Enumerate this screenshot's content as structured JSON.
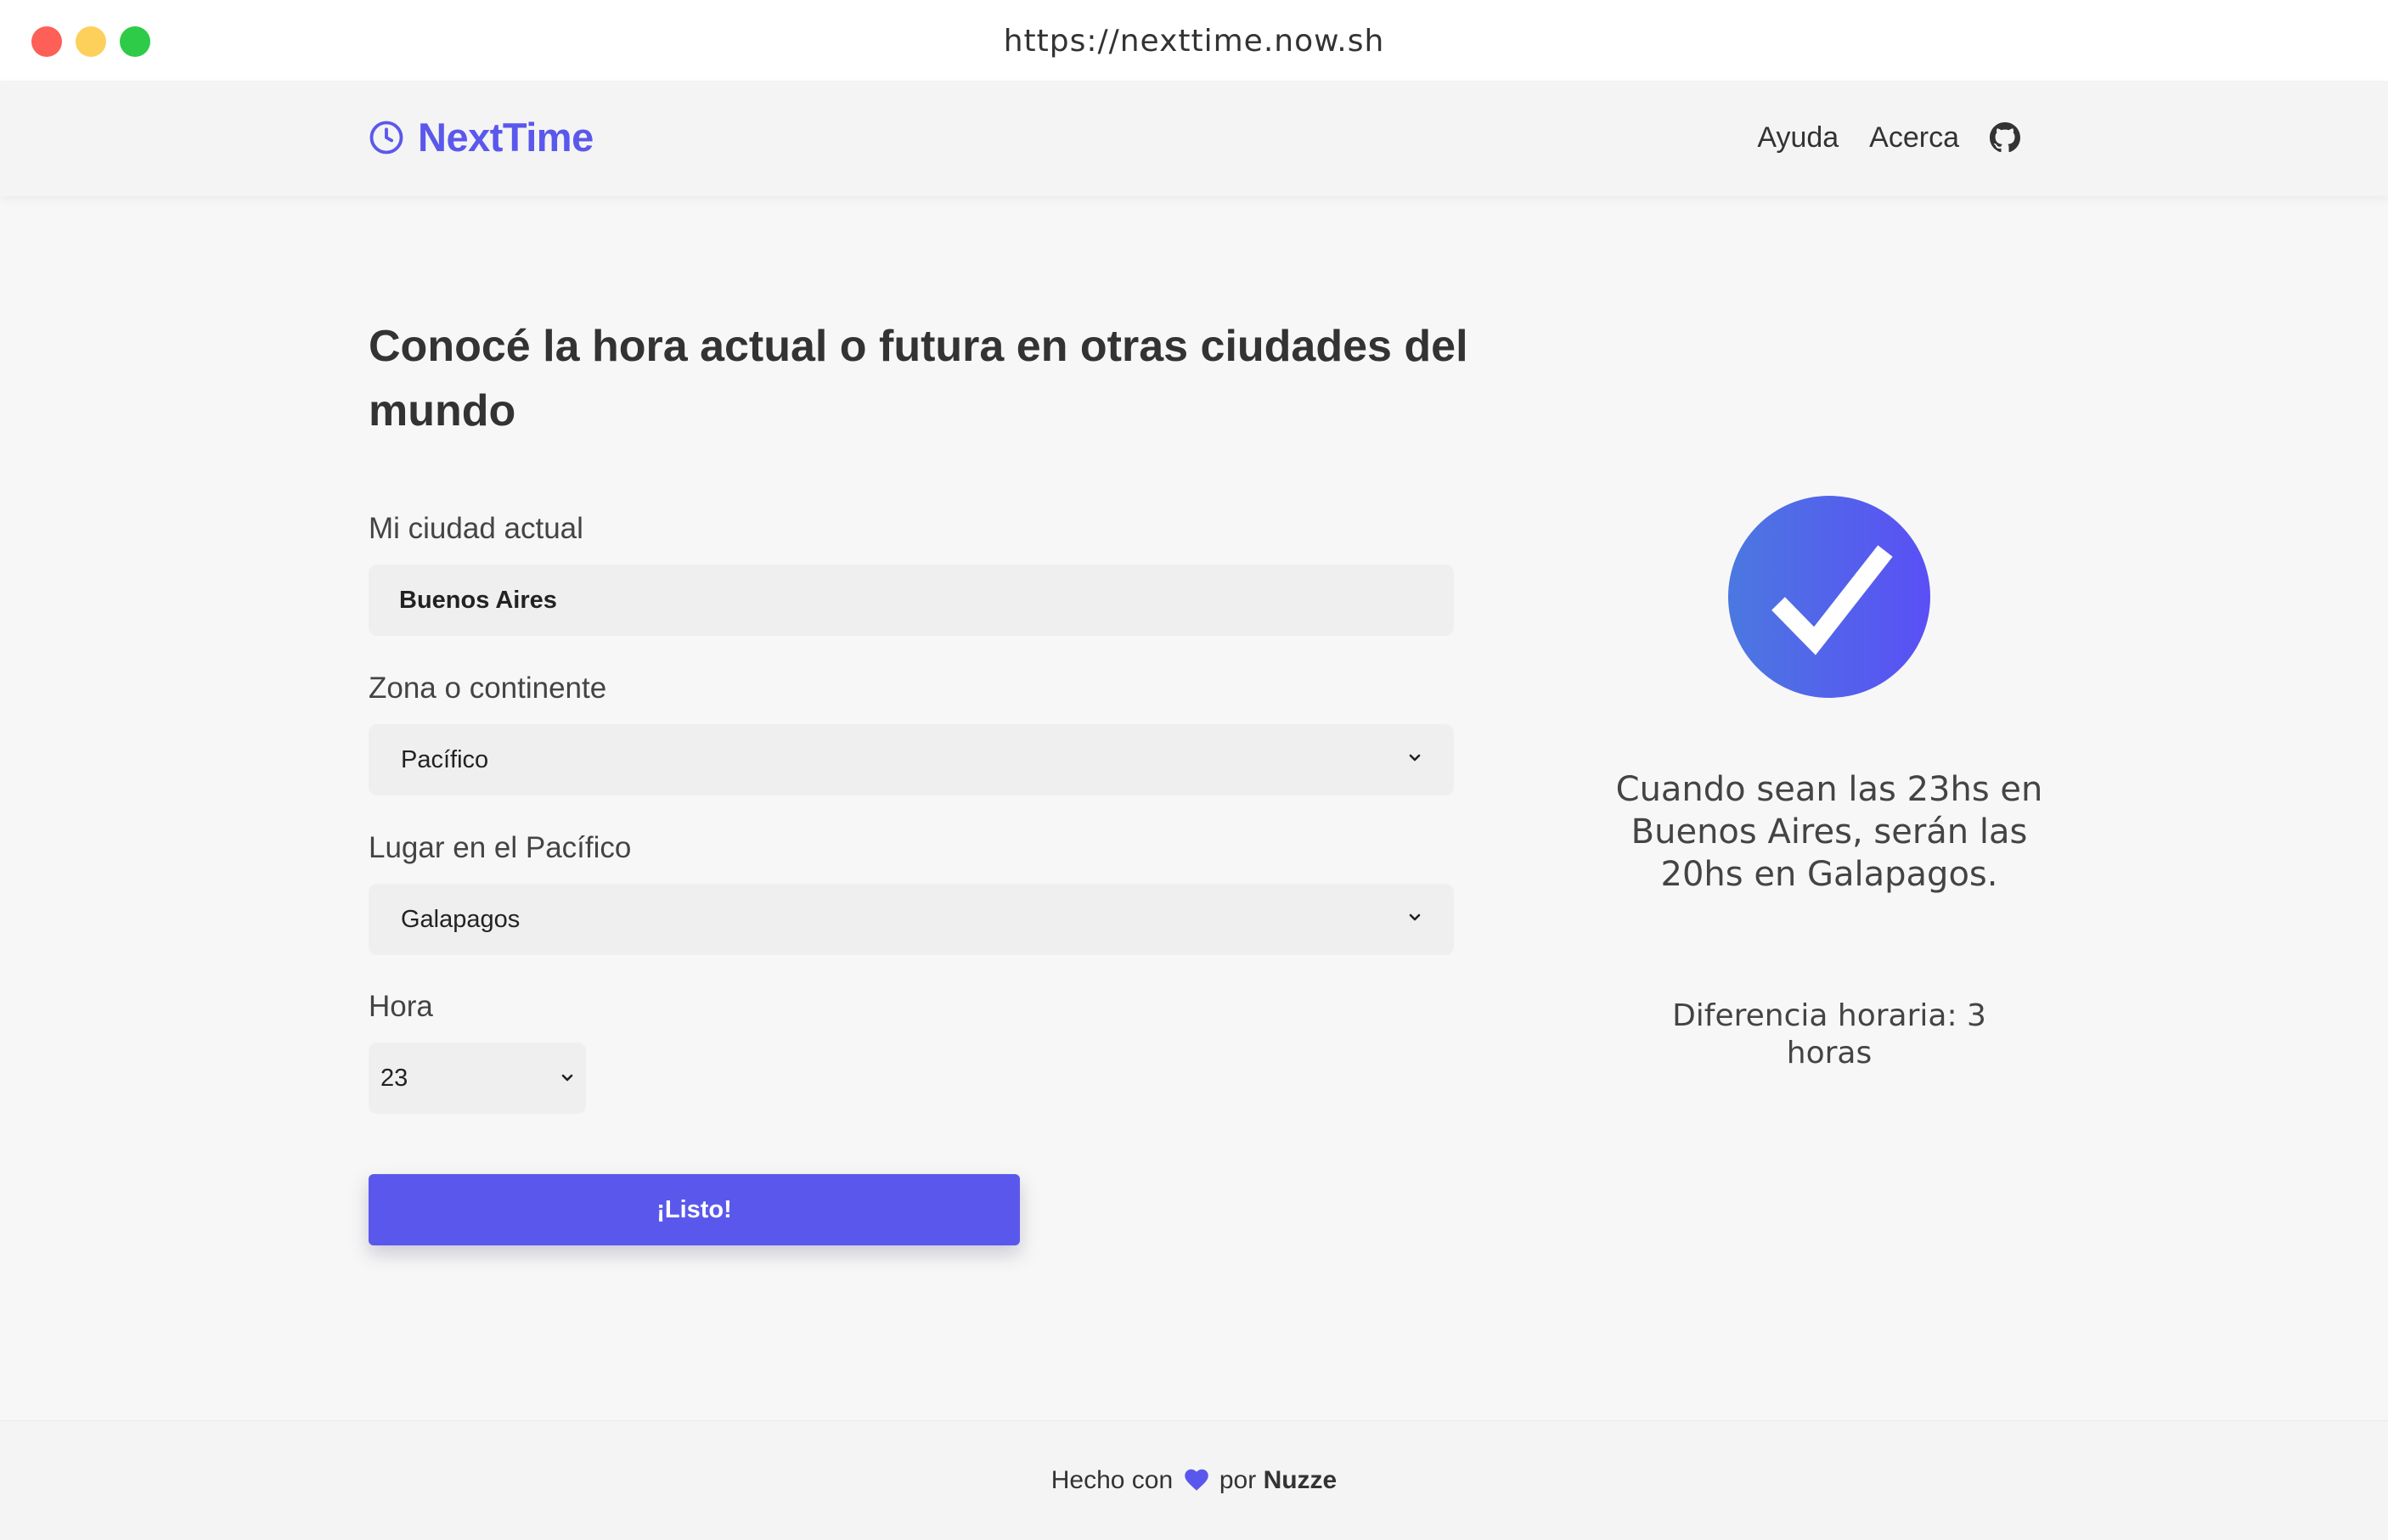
{
  "browser": {
    "url": "https://nexttime.now.sh"
  },
  "header": {
    "brand": "NextTime",
    "brand_icon": "clock-icon",
    "nav": {
      "help": "Ayuda",
      "about": "Acerca",
      "github_icon": "github-icon"
    }
  },
  "main": {
    "headline": "Conocé la hora actual o futura en otras ciudades del mundo",
    "fields": {
      "current_city": {
        "label": "Mi ciudad actual",
        "value": "Buenos Aires"
      },
      "zone": {
        "label": "Zona o continente",
        "value": "Pacífico"
      },
      "place": {
        "label": "Lugar en el Pacífico",
        "value": "Galapagos"
      },
      "hour": {
        "label": "Hora",
        "value": "23"
      }
    },
    "submit_label": "¡Listo!"
  },
  "result": {
    "icon": "check-circle-icon",
    "message": "Cuando sean las 23hs en Buenos Aires, serán las 20hs en Galapagos.",
    "difference": "Diferencia horaria: 3 horas"
  },
  "footer": {
    "prefix": "Hecho con",
    "heart_icon": "heart-icon",
    "middle": "por",
    "author": "Nuzze"
  },
  "colors": {
    "accent": "#5a58ec",
    "background": "#f7f7f7",
    "input_background": "#efefef",
    "text": "#333333",
    "traffic_red": "#fe5f57",
    "traffic_yellow": "#fdd05b",
    "traffic_green": "#2dcb48"
  }
}
